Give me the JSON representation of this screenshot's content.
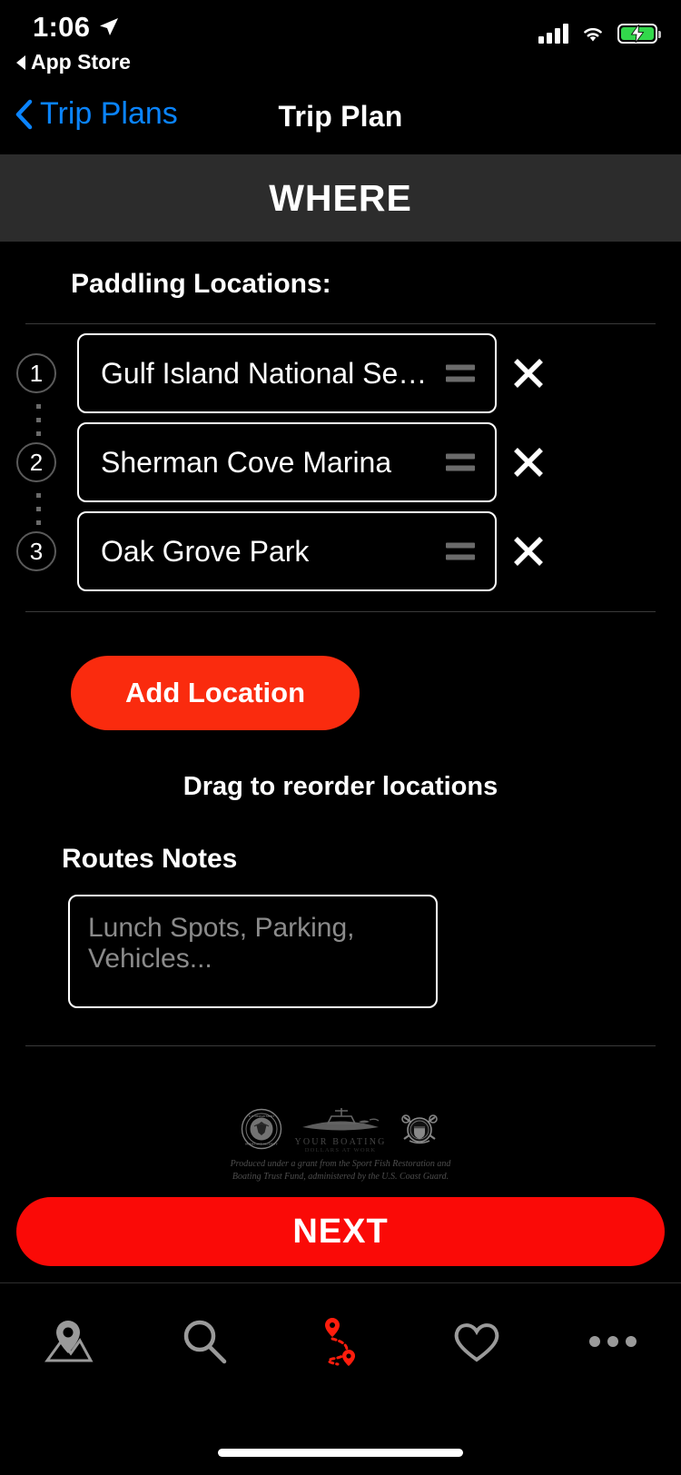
{
  "status_bar": {
    "time": "1:06",
    "back_app": "App Store",
    "location_icon": "location-arrow-icon",
    "signal_icon": "cellular-signal-icon",
    "wifi_icon": "wifi-icon",
    "battery_icon": "battery-charging-icon",
    "battery_color": "#32D74B"
  },
  "nav": {
    "back_label": "Trip Plans",
    "back_icon": "chevron-left-icon",
    "back_color": "#0A84FF",
    "title": "Trip Plan"
  },
  "section_header": {
    "title": "WHERE",
    "background": "#2c2c2c"
  },
  "locations_section": {
    "label": "Paddling Locations:",
    "items": [
      {
        "number": "1",
        "name": "Gulf Island National Seashore"
      },
      {
        "number": "2",
        "name": "Sherman Cove Marina"
      },
      {
        "number": "3",
        "name": "Oak Grove Park"
      }
    ],
    "drag_handle_icon": "drag-handle-icon",
    "delete_icon": "close-x-icon",
    "add_button": "Add Location",
    "add_button_color": "#FA2B0E",
    "hint": "Drag to reorder locations"
  },
  "notes_section": {
    "label": "Routes Notes",
    "placeholder": "Lunch Spots, Parking, Vehicles...",
    "value": ""
  },
  "footer": {
    "logo_left": "dhs-seal-icon",
    "logo_mid_title": "YOUR BOATING",
    "logo_mid_sub": "DOLLARS AT WORK",
    "logo_mid_icon": "boat-icon",
    "logo_right": "coast-guard-seal-icon",
    "fineprint_line1": "Produced under a grant from the Sport Fish Restoration and",
    "fineprint_line2": "Boating Trust Fund, administered by the U.S. Coast Guard."
  },
  "next_button": {
    "label": "NEXT",
    "color": "#FA0A07"
  },
  "tab_bar": {
    "items": [
      {
        "icon": "map-pin-icon",
        "active": false
      },
      {
        "icon": "search-icon",
        "active": false
      },
      {
        "icon": "route-trip-icon",
        "active": true
      },
      {
        "icon": "heart-icon",
        "active": false
      },
      {
        "icon": "more-ellipsis-icon",
        "active": false
      }
    ],
    "active_color": "#FF1D0D",
    "inactive_color": "#9a9a9a"
  }
}
